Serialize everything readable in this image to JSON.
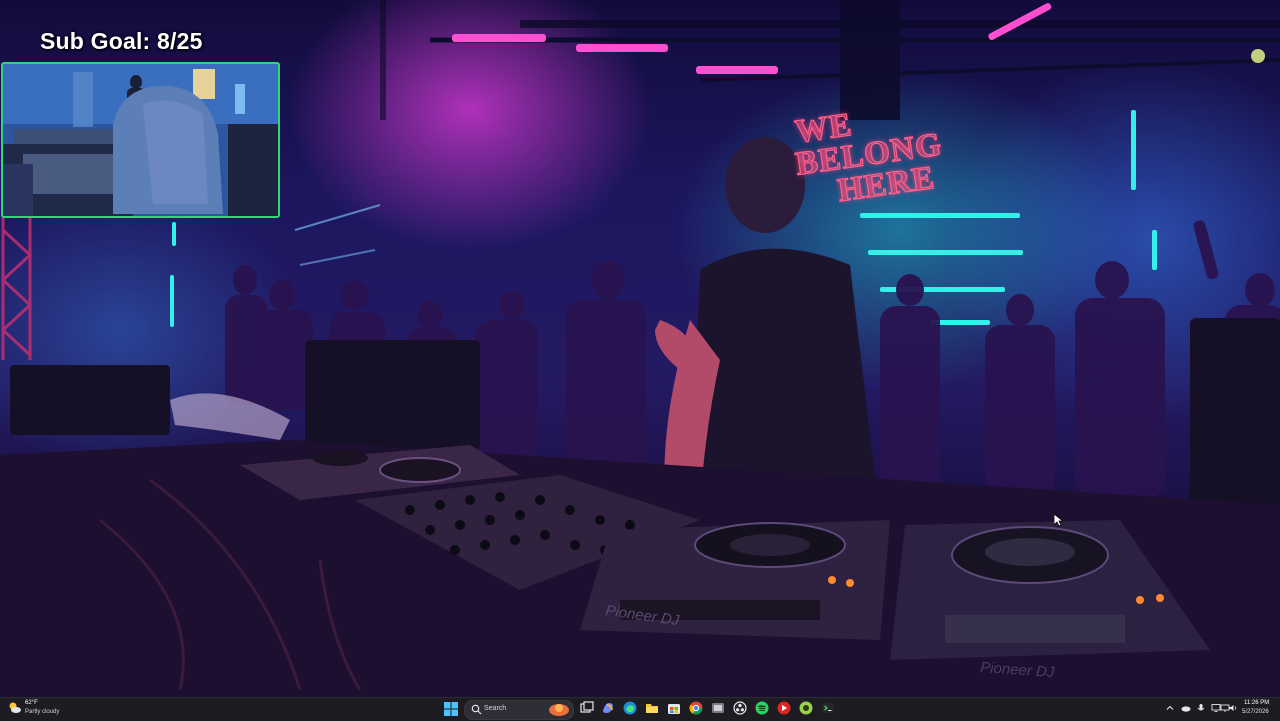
{
  "overlay": {
    "sub_goal": "Sub Goal: 8/25",
    "sign_lines": [
      "WE",
      "BELONG",
      "HERE"
    ]
  },
  "stream": {
    "scene": "dj-performance",
    "equipment_brand": "Pioneer DJ"
  },
  "taskbar": {
    "weather": {
      "icon": "partly-cloudy-icon",
      "temp": "62°F",
      "condition": "Partly cloudy"
    },
    "search_placeholder": "Search",
    "apps": [
      "search-highlight-icon",
      "task-view-icon",
      "copilot-icon",
      "edge-icon",
      "file-explorer-icon",
      "store-icon",
      "chrome-icon",
      "windows-app-icon",
      "obs-icon",
      "spotify-icon",
      "red-app-icon",
      "green-app-icon",
      "terminal-icon"
    ],
    "tray": [
      "chevron-up-icon",
      "onedrive-icon",
      "cloud-icon",
      "microphone-icon",
      "monitor-icon",
      "network-icon",
      "volume-icon"
    ],
    "clock": {
      "time": "11:26 PM",
      "date": "5/27/2026"
    }
  },
  "colors": {
    "neon_pink": "#ff5f8a",
    "neon_magenta": "#e13cdc",
    "neon_cyan": "#29e6e0",
    "webcam_border": "#2fd67a",
    "taskbar_bg": "#1c1c22"
  }
}
